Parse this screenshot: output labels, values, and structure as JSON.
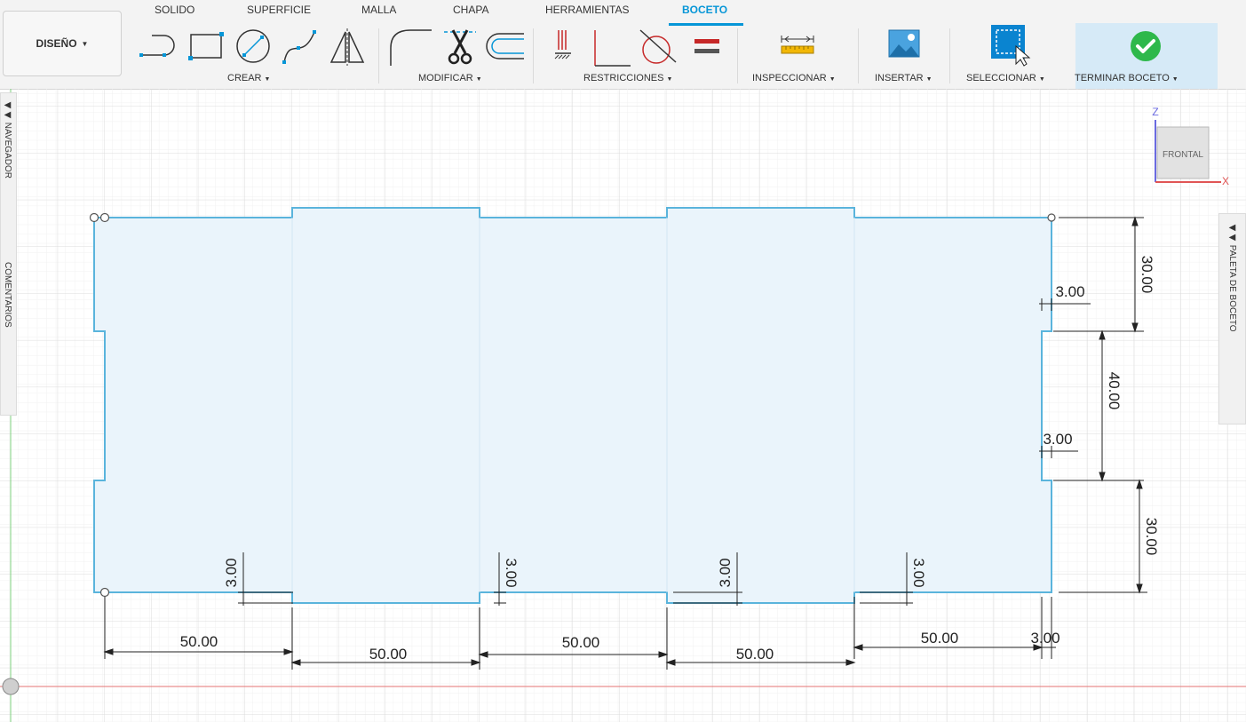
{
  "workspace": {
    "label": "DISEÑO"
  },
  "tabs": [
    {
      "label": "SOLIDO"
    },
    {
      "label": "SUPERFICIE"
    },
    {
      "label": "MALLA"
    },
    {
      "label": "CHAPA"
    },
    {
      "label": "HERRAMIENTAS"
    },
    {
      "label": "BOCETO",
      "active": true
    }
  ],
  "groups": {
    "create": "CREAR",
    "modify": "MODIFICAR",
    "constraints": "RESTRICCIONES",
    "inspect": "INSPECCIONAR",
    "insert": "INSERTAR",
    "select": "SELECCIONAR",
    "finish": "TERMINAR BOCETO"
  },
  "panels": {
    "navigator": "NAVEGADOR",
    "comments": "COMENTARIOS",
    "sketch_palette": "PALETA DE BOCETO"
  },
  "viewcube": {
    "face": "FRONTAL",
    "axis_z": "Z",
    "axis_x": "X"
  },
  "dimensions": {
    "bottom": [
      "50.00",
      "50.00",
      "50.00",
      "50.00",
      "50.00"
    ],
    "tab_depths": [
      "3.00",
      "3.00",
      "3.00",
      "3.00"
    ],
    "right_vertical": [
      "30.00",
      "40.00",
      "30.00"
    ],
    "right_depths": [
      "3.00",
      "3.00"
    ],
    "corner": "3.00"
  },
  "colors": {
    "accent": "#0696d7",
    "sketch_line": "#5ab4dc",
    "sketch_fill": "#eaf4fb",
    "finish_check": "#2eb84b",
    "x_axis": "#e57373",
    "z_axis": "#66bb6a"
  }
}
